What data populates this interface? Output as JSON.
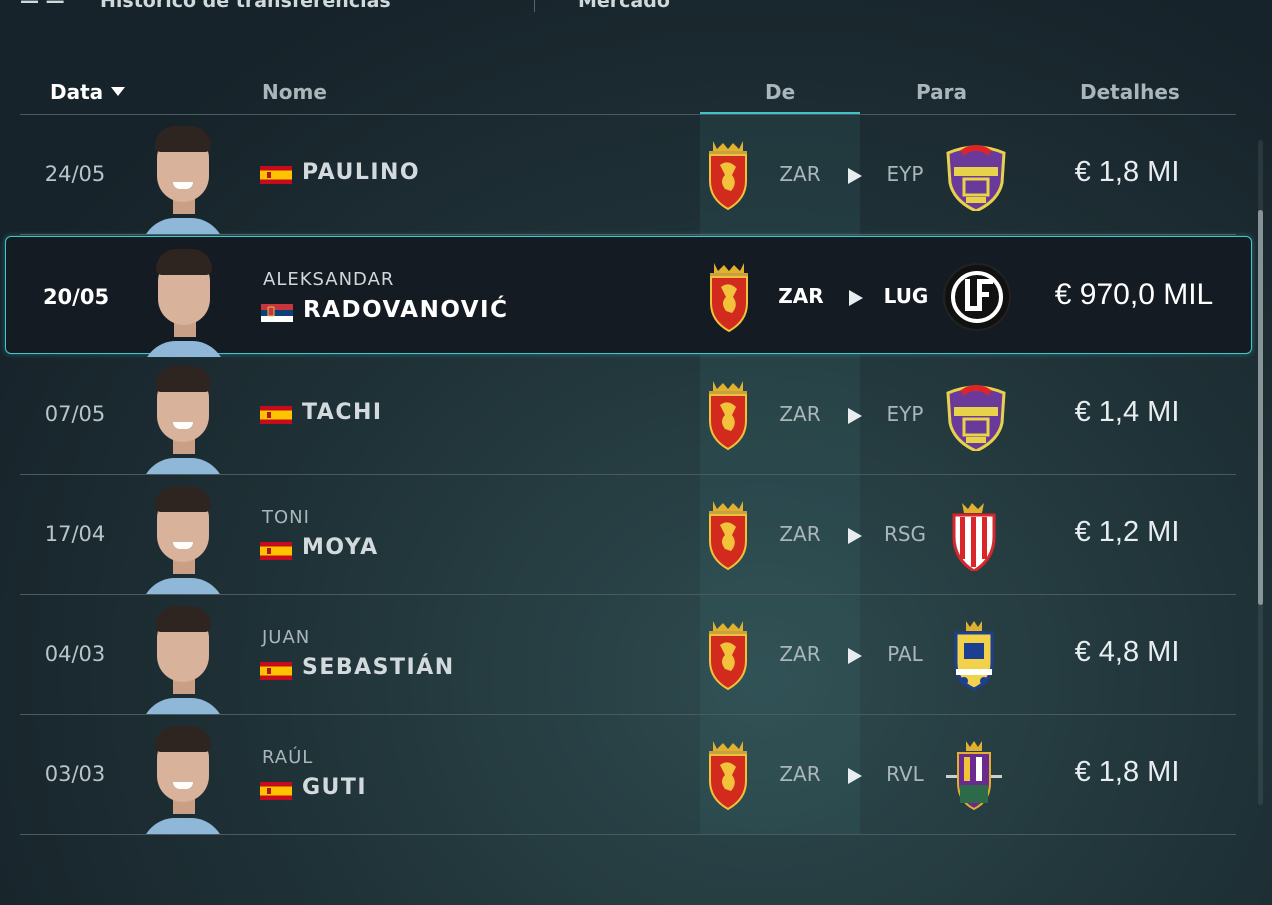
{
  "top_strip": {
    "left_text": "— —",
    "title": "Histórico de transferências",
    "right_text": "Mercado"
  },
  "table": {
    "headers": {
      "date": "Data",
      "name": "Nome",
      "from": "De",
      "to": "Para",
      "details": "Detalhes"
    },
    "accent_color": "#41c3c8",
    "rows": [
      {
        "date": "24/05",
        "first_name": "",
        "last_name": "PAULINO",
        "nationality_flag": "spain-flag-icon",
        "from": "ZAR",
        "to": "EYP",
        "to_crest": "eyupspor-crest-icon",
        "fee": "€ 1,8 MI",
        "selected": false
      },
      {
        "date": "20/05",
        "first_name": "ALEKSANDAR",
        "last_name": "RADOVANOVIĆ",
        "nationality_flag": "serbia-flag-icon",
        "from": "ZAR",
        "to": "LUG",
        "to_crest": "lugano-crest-icon",
        "fee": "€ 970,0 MIL",
        "selected": true
      },
      {
        "date": "07/05",
        "first_name": "",
        "last_name": "TACHI",
        "nationality_flag": "spain-flag-icon",
        "from": "ZAR",
        "to": "EYP",
        "to_crest": "eyupspor-crest-icon",
        "fee": "€ 1,4 MI",
        "selected": false
      },
      {
        "date": "17/04",
        "first_name": "TONI",
        "last_name": "MOYA",
        "nationality_flag": "spain-flag-icon",
        "from": "ZAR",
        "to": "RSG",
        "to_crest": "sporting-gijon-crest-icon",
        "fee": "€ 1,2 MI",
        "selected": false
      },
      {
        "date": "04/03",
        "first_name": "JUAN",
        "last_name": "SEBASTIÁN",
        "nationality_flag": "spain-flag-icon",
        "from": "ZAR",
        "to": "PAL",
        "to_crest": "las-palmas-crest-icon",
        "fee": "€ 4,8 MI",
        "selected": false
      },
      {
        "date": "03/03",
        "first_name": "RAÚL",
        "last_name": "GUTI",
        "nationality_flag": "spain-flag-icon",
        "from": "ZAR",
        "to": "RVL",
        "to_crest": "valladolid-crest-icon",
        "fee": "€ 1,8 MI",
        "selected": false
      }
    ]
  }
}
